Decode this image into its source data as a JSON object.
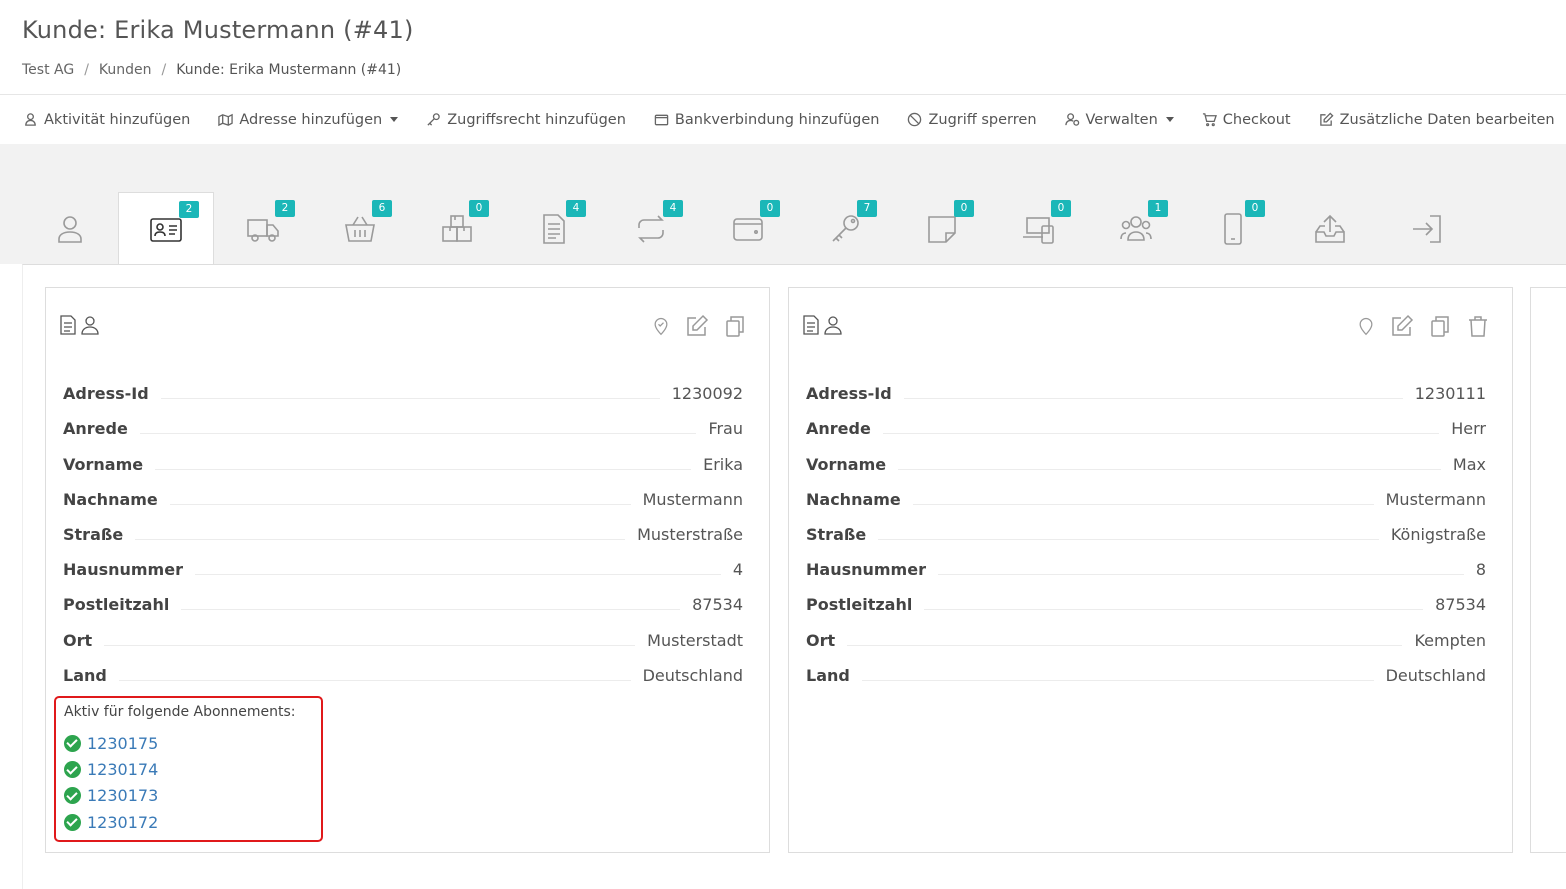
{
  "page": {
    "title": "Kunde: Erika Mustermann (#41)",
    "breadcrumb": [
      "Test AG",
      "Kunden",
      "Kunde: Erika Mustermann (#41)"
    ]
  },
  "toolbar": {
    "items": [
      {
        "label": "Aktivität hinzufügen",
        "icon": "user-activity-icon"
      },
      {
        "label": "Adresse hinzufügen",
        "icon": "map-icon",
        "dropdown": true
      },
      {
        "label": "Zugriffsrecht hinzufügen",
        "icon": "key-icon"
      },
      {
        "label": "Bankverbindung hinzufügen",
        "icon": "wallet-icon"
      },
      {
        "label": "Zugriff sperren",
        "icon": "ban-icon"
      },
      {
        "label": "Verwalten",
        "icon": "user-gear-icon",
        "dropdown": true
      },
      {
        "label": "Checkout",
        "icon": "cart-icon"
      },
      {
        "label": "Zusätzliche Daten bearbeiten",
        "icon": "edit-icon"
      }
    ]
  },
  "tabs": [
    {
      "icon": "user-icon",
      "badge": null
    },
    {
      "icon": "address-card-icon",
      "badge": "2",
      "active": true
    },
    {
      "icon": "truck-icon",
      "badge": "2"
    },
    {
      "icon": "basket-icon",
      "badge": "6"
    },
    {
      "icon": "boxes-icon",
      "badge": "0"
    },
    {
      "icon": "invoice-icon",
      "badge": "4"
    },
    {
      "icon": "repeat-icon",
      "badge": "4"
    },
    {
      "icon": "wallet-icon",
      "badge": "0"
    },
    {
      "icon": "key-icon",
      "badge": "7"
    },
    {
      "icon": "note-icon",
      "badge": "0"
    },
    {
      "icon": "devices-icon",
      "badge": "0"
    },
    {
      "icon": "users-icon",
      "badge": "1"
    },
    {
      "icon": "mobile-icon",
      "badge": "0"
    },
    {
      "icon": "upload-tray-icon",
      "badge": null
    },
    {
      "icon": "login-icon",
      "badge": null
    }
  ],
  "addresses": [
    {
      "fields": [
        {
          "label": "Adress-Id",
          "value": "1230092"
        },
        {
          "label": "Anrede",
          "value": "Frau"
        },
        {
          "label": "Vorname",
          "value": "Erika"
        },
        {
          "label": "Nachname",
          "value": "Mustermann"
        },
        {
          "label": "Straße",
          "value": "Musterstraße"
        },
        {
          "label": "Hausnummer",
          "value": "4"
        },
        {
          "label": "Postleitzahl",
          "value": "87534"
        },
        {
          "label": "Ort",
          "value": "Musterstadt"
        },
        {
          "label": "Land",
          "value": "Deutschland"
        }
      ],
      "subscriptions_title": "Aktiv für folgende Abonnements:",
      "subscriptions": [
        "1230175",
        "1230174",
        "1230173",
        "1230172"
      ]
    },
    {
      "fields": [
        {
          "label": "Adress-Id",
          "value": "1230111"
        },
        {
          "label": "Anrede",
          "value": "Herr"
        },
        {
          "label": "Vorname",
          "value": "Max"
        },
        {
          "label": "Nachname",
          "value": "Mustermann"
        },
        {
          "label": "Straße",
          "value": "Königstraße"
        },
        {
          "label": "Hausnummer",
          "value": "8"
        },
        {
          "label": "Postleitzahl",
          "value": "87534"
        },
        {
          "label": "Ort",
          "value": "Kempten"
        },
        {
          "label": "Land",
          "value": "Deutschland"
        }
      ]
    }
  ],
  "colors": {
    "accent_badge": "#1bb7b8",
    "highlight_border": "#e0191b",
    "check_green": "#2da44e",
    "link_blue": "#3a7ab7"
  }
}
